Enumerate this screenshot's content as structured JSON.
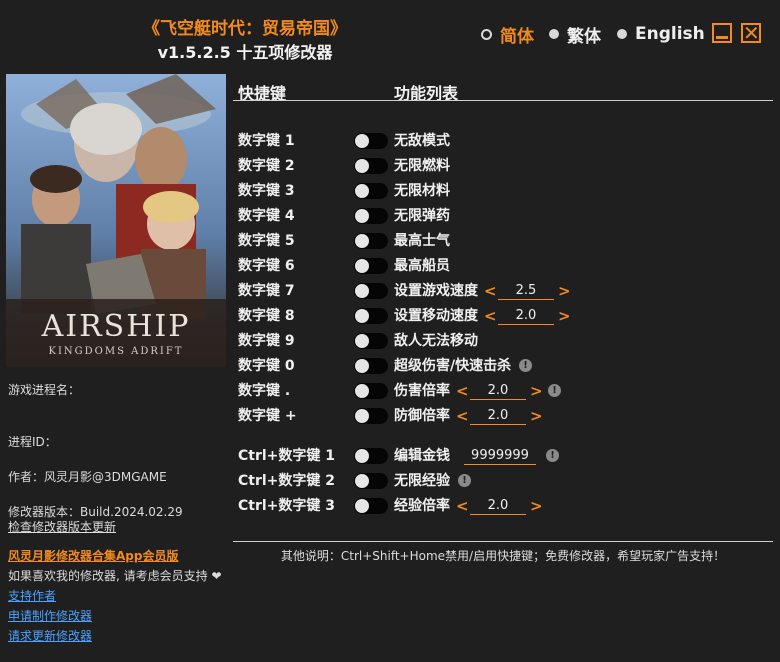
{
  "app": {
    "title_cn": "《飞空艇时代：贸易帝国》",
    "subtitle": "v1.5.2.5 十五项修改器"
  },
  "languages": [
    {
      "label": "简体",
      "selected": true
    },
    {
      "label": "繁体",
      "selected": false
    },
    {
      "label": "English",
      "selected": false
    }
  ],
  "window": {
    "minimize_icon": "minimize-icon",
    "close_icon": "close-icon"
  },
  "cover": {
    "logo_main": "AIRSHIP",
    "logo_sub": "KINGDOMS ADRIFT"
  },
  "sidebar": {
    "process_name_label": "游戏进程名：",
    "process_id_label": "进程ID：",
    "author": "作者：风灵月影@3DMGAME",
    "version": "修改器版本：Build.2024.02.29",
    "check_update": "检查修改器版本更新",
    "vip_link": "风灵月影修改器合集App会员版",
    "support_text": "如果喜欢我的修改器, 请考虑会员支持",
    "heart_icon": "heart-icon",
    "links": [
      "支持作者",
      "申请制作修改器",
      "请求更新修改器"
    ]
  },
  "table": {
    "header_key": "快捷键",
    "header_feature": "功能列表",
    "rows": [
      {
        "key": "数字键 1",
        "feature": "无敌模式"
      },
      {
        "key": "数字键 2",
        "feature": "无限燃料"
      },
      {
        "key": "数字键 3",
        "feature": "无限材料"
      },
      {
        "key": "数字键 4",
        "feature": "无限弹药"
      },
      {
        "key": "数字键 5",
        "feature": "最高士气"
      },
      {
        "key": "数字键 6",
        "feature": "最高船员"
      },
      {
        "key": "数字键 7",
        "feature": "设置游戏速度",
        "value": "2.5"
      },
      {
        "key": "数字键 8",
        "feature": "设置移动速度",
        "value": "2.0"
      },
      {
        "key": "数字键 9",
        "feature": "敌人无法移动"
      },
      {
        "key": "数字键 0",
        "feature": "超级伤害/快速击杀",
        "info": "!"
      },
      {
        "key": "数字键 .",
        "feature": "伤害倍率",
        "value": "2.0",
        "info": "!"
      },
      {
        "key": "数字键 +",
        "feature": "防御倍率",
        "value": "2.0"
      },
      {
        "key": "Ctrl+数字键 1",
        "feature": "编辑金钱",
        "value": "9999999",
        "info": "!"
      },
      {
        "key": "Ctrl+数字键 2",
        "feature": "无限经验",
        "info": "!"
      },
      {
        "key": "Ctrl+数字键 3",
        "feature": "经验倍率",
        "value": "2.0"
      }
    ]
  },
  "arrows": {
    "left": "<",
    "right": ">"
  },
  "footer": "其他说明：Ctrl+Shift+Home禁用/启用快捷键；免费修改器，希望玩家广告支持！",
  "colors": {
    "accent": "#f28a1e",
    "background": "#1f1f1f",
    "link": "#4aa2ff"
  }
}
